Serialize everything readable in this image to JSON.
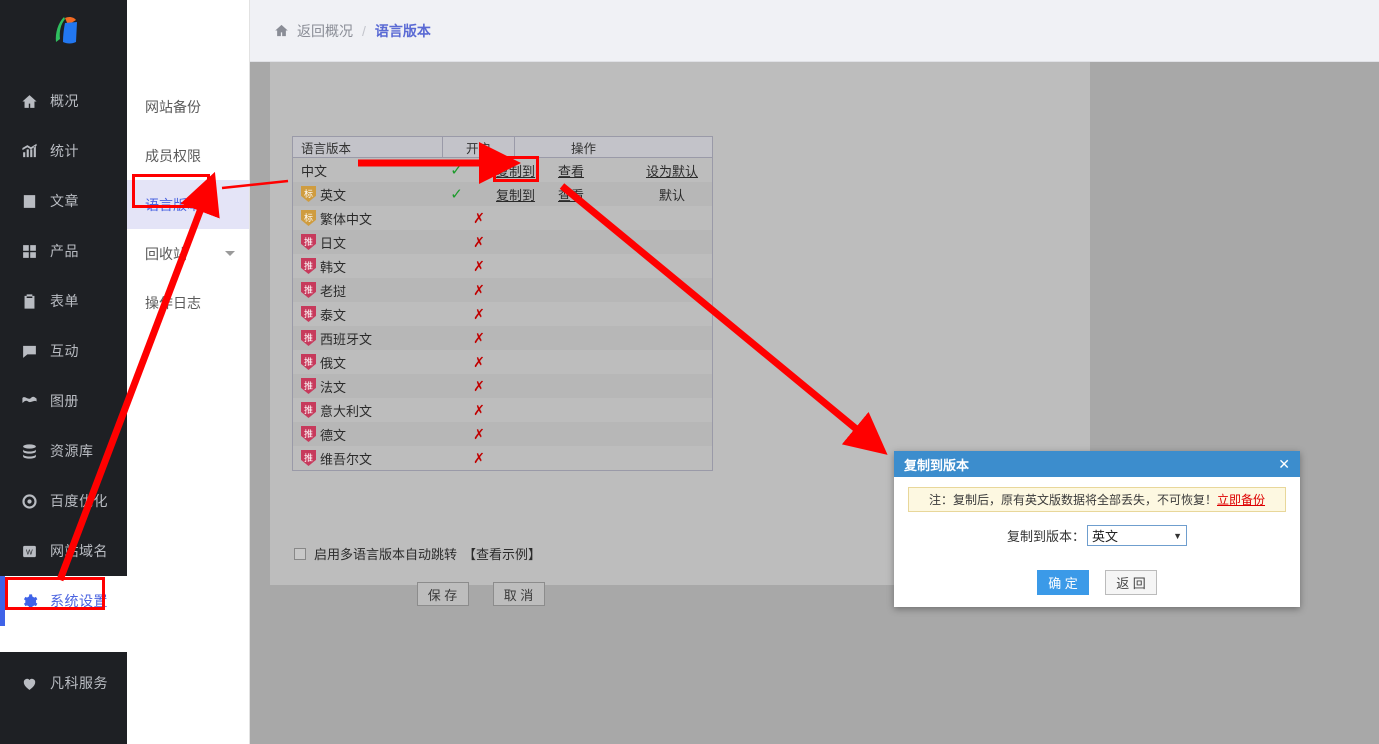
{
  "brand": {
    "logo_name": "fkw-logo"
  },
  "sidebar": {
    "items": [
      {
        "label": "概况",
        "icon": "home-icon"
      },
      {
        "label": "统计",
        "icon": "chart-icon"
      },
      {
        "label": "文章",
        "icon": "article-icon"
      },
      {
        "label": "产品",
        "icon": "grid-icon"
      },
      {
        "label": "表单",
        "icon": "clipboard-icon"
      },
      {
        "label": "互动",
        "icon": "chat-icon"
      },
      {
        "label": "图册",
        "icon": "album-icon"
      },
      {
        "label": "资源库",
        "icon": "database-icon"
      },
      {
        "label": "百度优化",
        "icon": "baidu-icon"
      },
      {
        "label": "网站域名",
        "icon": "domain-w-icon"
      },
      {
        "label": "系统设置",
        "icon": "gear-icon"
      }
    ],
    "service_item": {
      "label": "凡科服务",
      "icon": "heart-icon"
    }
  },
  "secondary_nav": {
    "items": [
      {
        "label": "网站备份"
      },
      {
        "label": "成员权限"
      },
      {
        "label": "语言版本"
      },
      {
        "label": "回收站"
      },
      {
        "label": "操作日志"
      }
    ]
  },
  "breadcrumb": {
    "home_icon": "home-icon",
    "back": "返回概况",
    "separator": "/",
    "current": "语言版本"
  },
  "table": {
    "headers": {
      "language": "语言版本",
      "enabled": "开启",
      "actions": "操作"
    },
    "rows": [
      {
        "name": "中文",
        "badge": "",
        "enabled": "✓",
        "copy": "复制到",
        "view": "查看",
        "default": "设为默认",
        "default_is_link": true
      },
      {
        "name": "英文",
        "badge": "标",
        "badge_type": "gold",
        "enabled": "✓",
        "copy": "复制到",
        "view": "查看",
        "default": "默认",
        "default_is_link": false
      },
      {
        "name": "繁体中文",
        "badge": "标",
        "badge_type": "gold",
        "enabled": "✗",
        "copy": "",
        "view": "",
        "default": ""
      },
      {
        "name": "日文",
        "badge": "推",
        "badge_type": "pink",
        "enabled": "✗",
        "copy": "",
        "view": "",
        "default": ""
      },
      {
        "name": "韩文",
        "badge": "推",
        "badge_type": "pink",
        "enabled": "✗",
        "copy": "",
        "view": "",
        "default": ""
      },
      {
        "name": "老挝",
        "badge": "推",
        "badge_type": "pink",
        "enabled": "✗",
        "copy": "",
        "view": "",
        "default": ""
      },
      {
        "name": "泰文",
        "badge": "推",
        "badge_type": "pink",
        "enabled": "✗",
        "copy": "",
        "view": "",
        "default": ""
      },
      {
        "name": "西班牙文",
        "badge": "推",
        "badge_type": "pink",
        "enabled": "✗",
        "copy": "",
        "view": "",
        "default": ""
      },
      {
        "name": "俄文",
        "badge": "推",
        "badge_type": "pink",
        "enabled": "✗",
        "copy": "",
        "view": "",
        "default": ""
      },
      {
        "name": "法文",
        "badge": "推",
        "badge_type": "pink",
        "enabled": "✗",
        "copy": "",
        "view": "",
        "default": ""
      },
      {
        "name": "意大利文",
        "badge": "推",
        "badge_type": "pink",
        "enabled": "✗",
        "copy": "",
        "view": "",
        "default": ""
      },
      {
        "name": "德文",
        "badge": "推",
        "badge_type": "pink",
        "enabled": "✗",
        "copy": "",
        "view": "",
        "default": ""
      },
      {
        "name": "维吾尔文",
        "badge": "推",
        "badge_type": "pink",
        "enabled": "✗",
        "copy": "",
        "view": "",
        "default": ""
      }
    ]
  },
  "form": {
    "auto_redirect_label": "启用多语言版本自动跳转",
    "example_link": "【查看示例】",
    "save_label": "保 存",
    "cancel_label": "取 消"
  },
  "modal": {
    "title": "复制到版本",
    "close_icon": "close-icon",
    "note_prefix": "注：复制后，原有英文版数据将全部丢失，不可恢复！",
    "note_link": "立即备份",
    "select_label": "复制到版本：",
    "select_value": "英文",
    "select_caret": "▼",
    "confirm_label": "确 定",
    "back_label": "返 回"
  },
  "colors": {
    "accent_blue": "#3f63e8",
    "modal_blue": "#3c8dcd",
    "annotation_red": "#ff0000",
    "check_green": "#1c9b2b",
    "cross_red": "#c00000"
  }
}
